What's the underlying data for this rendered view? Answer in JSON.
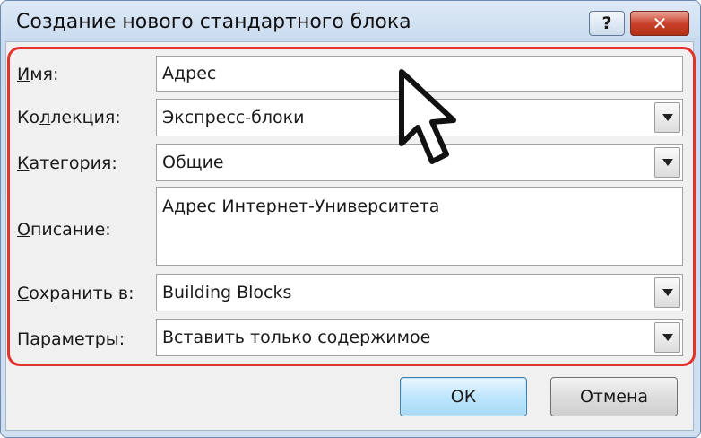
{
  "window": {
    "title": "Создание нового стандартного блока",
    "help_label": "?",
    "close_label": "✕"
  },
  "form": {
    "name": {
      "label_ul": "И",
      "label_rest": "мя:",
      "value": "Адрес"
    },
    "gallery": {
      "label_pre": "Ко",
      "label_ul": "л",
      "label_rest": "лекция:",
      "value": "Экспресс-блоки"
    },
    "category": {
      "label_ul": "К",
      "label_rest": "атегория:",
      "value": "Общие"
    },
    "description": {
      "label_ul": "О",
      "label_rest": "писание:",
      "value": "Адрес Интернет-Университета"
    },
    "save_in": {
      "label_ul": "С",
      "label_rest": "охранить в:",
      "value": "Building Blocks"
    },
    "options": {
      "label_ul": "П",
      "label_rest": "араметры:",
      "value": "Вставить только содержимое"
    }
  },
  "buttons": {
    "ok": "ОК",
    "cancel": "Отмена"
  },
  "colors": {
    "highlight": "#e2342b",
    "close_button": "#c8402a",
    "ok_button": "#bee6fd"
  },
  "icons": [
    "help-icon",
    "close-icon",
    "dropdown-arrow-icon",
    "mouse-pointer-icon"
  ]
}
